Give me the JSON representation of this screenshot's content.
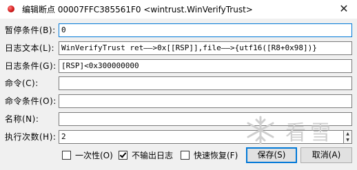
{
  "window": {
    "title": "编辑断点 00007FFC385561F0 <wintrust.WinVerifyTrust>",
    "close_glyph": "✕"
  },
  "fields": [
    {
      "label": "暂停条件(B):",
      "value": "0"
    },
    {
      "label": "日志文本(L):",
      "value": "WinVerifyTrust ret——>0x[[RSP]],file——>{utf16([R8+0x98])}"
    },
    {
      "label": "日志条件(G):",
      "value": "[RSP]<0x300000000"
    },
    {
      "label": "命令(C):",
      "value": ""
    },
    {
      "label": "命令条件(O):",
      "value": ""
    },
    {
      "label": "名称(N):",
      "value": ""
    },
    {
      "label": "执行次数(H):",
      "value": "2"
    }
  ],
  "spinner": {
    "up": "▲",
    "down": "▼"
  },
  "checkboxes": [
    {
      "label": "一次性(O)",
      "checked": false
    },
    {
      "label": "不输出日志",
      "checked": true
    },
    {
      "label": "快速恢复(F)",
      "checked": false
    }
  ],
  "buttons": {
    "save": "保存(S)",
    "cancel": "取消(A)"
  },
  "watermark": {
    "text": "看雪",
    "icon": "snowflake-logo-icon"
  }
}
